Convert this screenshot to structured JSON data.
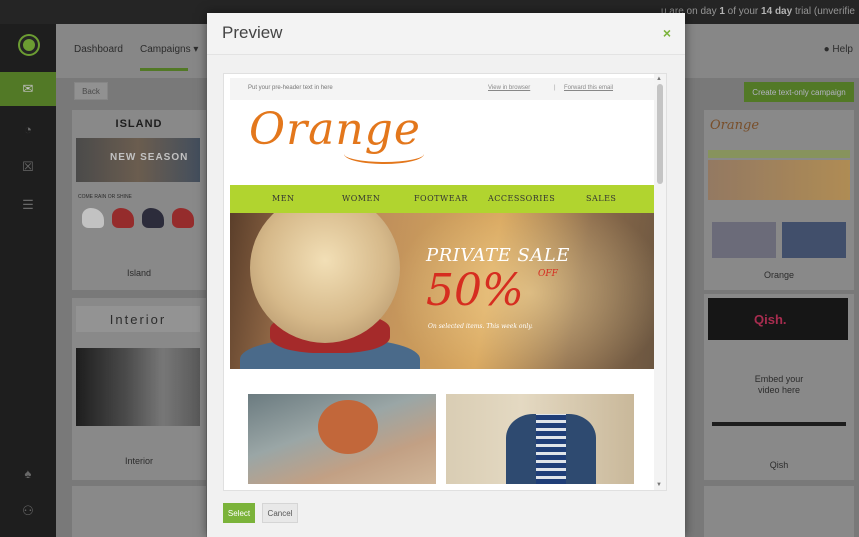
{
  "trial_banner": {
    "prefix": "u are on day ",
    "day": "1",
    "middle": " of your ",
    "days": "14 day",
    "suffix": " trial (unverifie"
  },
  "app_nav": {
    "dashboard": "Dashboard",
    "campaigns": "Campaigns ▾",
    "help": "Help"
  },
  "toolbar": {
    "back": "Back",
    "create_text_only": "Create text-only campaign"
  },
  "templates": {
    "island": {
      "title": "ISLAND",
      "hero_text": "NEW SEASON",
      "sub": "COME RAIN OR SHINE",
      "name": "Island"
    },
    "interior": {
      "title": "Interior",
      "name": "Interior"
    },
    "orange": {
      "logo": "Orange",
      "name": "Orange"
    },
    "qish": {
      "logo": "Qish.",
      "embed_line1": "Embed your",
      "embed_line2": "video here",
      "name": "Qish"
    }
  },
  "modal": {
    "title": "Preview",
    "close": "×",
    "select": "Select",
    "cancel": "Cancel"
  },
  "email": {
    "preheader": "Put your pre-header text in here",
    "view_in_browser": "View in browser",
    "separator": "|",
    "forward": "Forward this email",
    "logo": "Orange",
    "menu": [
      "MEN",
      "WOMEN",
      "FOOTWEAR",
      "ACCESSORIES",
      "SALES"
    ],
    "sale_title": "PRIVATE SALE",
    "sale_percent": "50%",
    "sale_off": "OFF",
    "sale_note": "On selected items. This week only."
  },
  "colors": {
    "accent": "#7bb33a",
    "menu_bg": "#b1d42f",
    "logo": "#e3771c",
    "sale": "#d62d20"
  },
  "icons": [
    "logo-icon",
    "mail-icon",
    "pie-chart-icon",
    "calendar-icon",
    "list-icon",
    "bell-icon",
    "users-icon",
    "help-icon",
    "close-icon"
  ]
}
